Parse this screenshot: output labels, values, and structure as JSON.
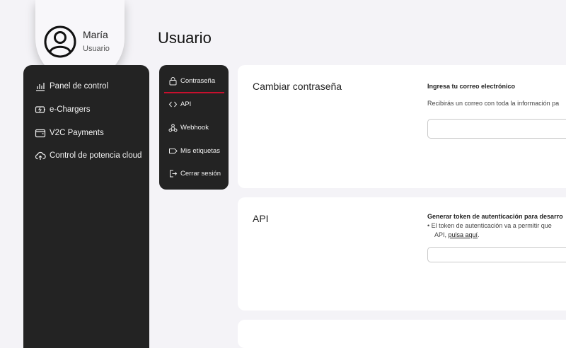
{
  "user": {
    "name": "María",
    "role": "Usuario"
  },
  "page": {
    "title": "Usuario"
  },
  "sidebar": {
    "items": [
      {
        "label": "Panel de control",
        "icon": "bar-chart-icon"
      },
      {
        "label": "e-Chargers",
        "icon": "battery-charge-icon"
      },
      {
        "label": "V2C Payments",
        "icon": "wallet-icon"
      },
      {
        "label": "Control de potencia cloud",
        "icon": "cloud-upload-icon"
      }
    ]
  },
  "submenu": {
    "items": [
      {
        "label": "Contraseña",
        "icon": "lock-icon"
      },
      {
        "label": "API",
        "icon": "code-icon"
      },
      {
        "label": "Webhook",
        "icon": "webhook-icon"
      },
      {
        "label": "Mis etiquetas",
        "icon": "tag-icon"
      },
      {
        "label": "Cerrar sesión",
        "icon": "logout-icon"
      }
    ],
    "active": "Contraseña"
  },
  "password_card": {
    "title": "Cambiar contraseña",
    "field_label": "Ingresa tu correo electrónico",
    "description": "Recibirás un correo con toda la información pa",
    "email_value": ""
  },
  "api_card": {
    "title": "API",
    "field_label": "Generar token de autenticación para desarro",
    "bullet_line1": "El token de autenticación va a permitir que",
    "bullet_line2_prefix": "API, ",
    "bullet_link": "pulsa aquí",
    "bullet_line2_suffix": ".",
    "token_value": ""
  },
  "colors": {
    "accent": "#c8102e",
    "dark_panel": "#232323",
    "background": "#f4f3f7"
  }
}
